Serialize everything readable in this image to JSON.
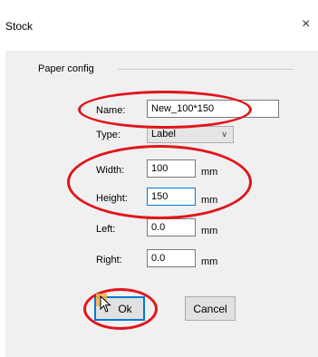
{
  "dialog": {
    "title": "Stock",
    "close_glyph": "×"
  },
  "group": {
    "label": "Paper config"
  },
  "fields": {
    "name": {
      "label": "Name:",
      "value": "New_100*150"
    },
    "type": {
      "label": "Type:",
      "value": "Label"
    },
    "width": {
      "label": "Width:",
      "value": "100",
      "unit": "mm"
    },
    "height": {
      "label": "Height:",
      "value": "150",
      "unit": "mm"
    },
    "left": {
      "label": "Left:",
      "value": "0.0",
      "unit": "mm"
    },
    "right": {
      "label": "Right:",
      "value": "0.0",
      "unit": "mm"
    }
  },
  "buttons": {
    "ok": "Ok",
    "cancel": "Cancel"
  },
  "colors": {
    "highlight_ring": "#e2141c",
    "focus": "#0078d7",
    "panel": "#f0f0f0"
  },
  "icons": {
    "close": "close-icon",
    "dropdown": "chevron-down-icon",
    "cursor": "mouse-pointer-icon"
  }
}
